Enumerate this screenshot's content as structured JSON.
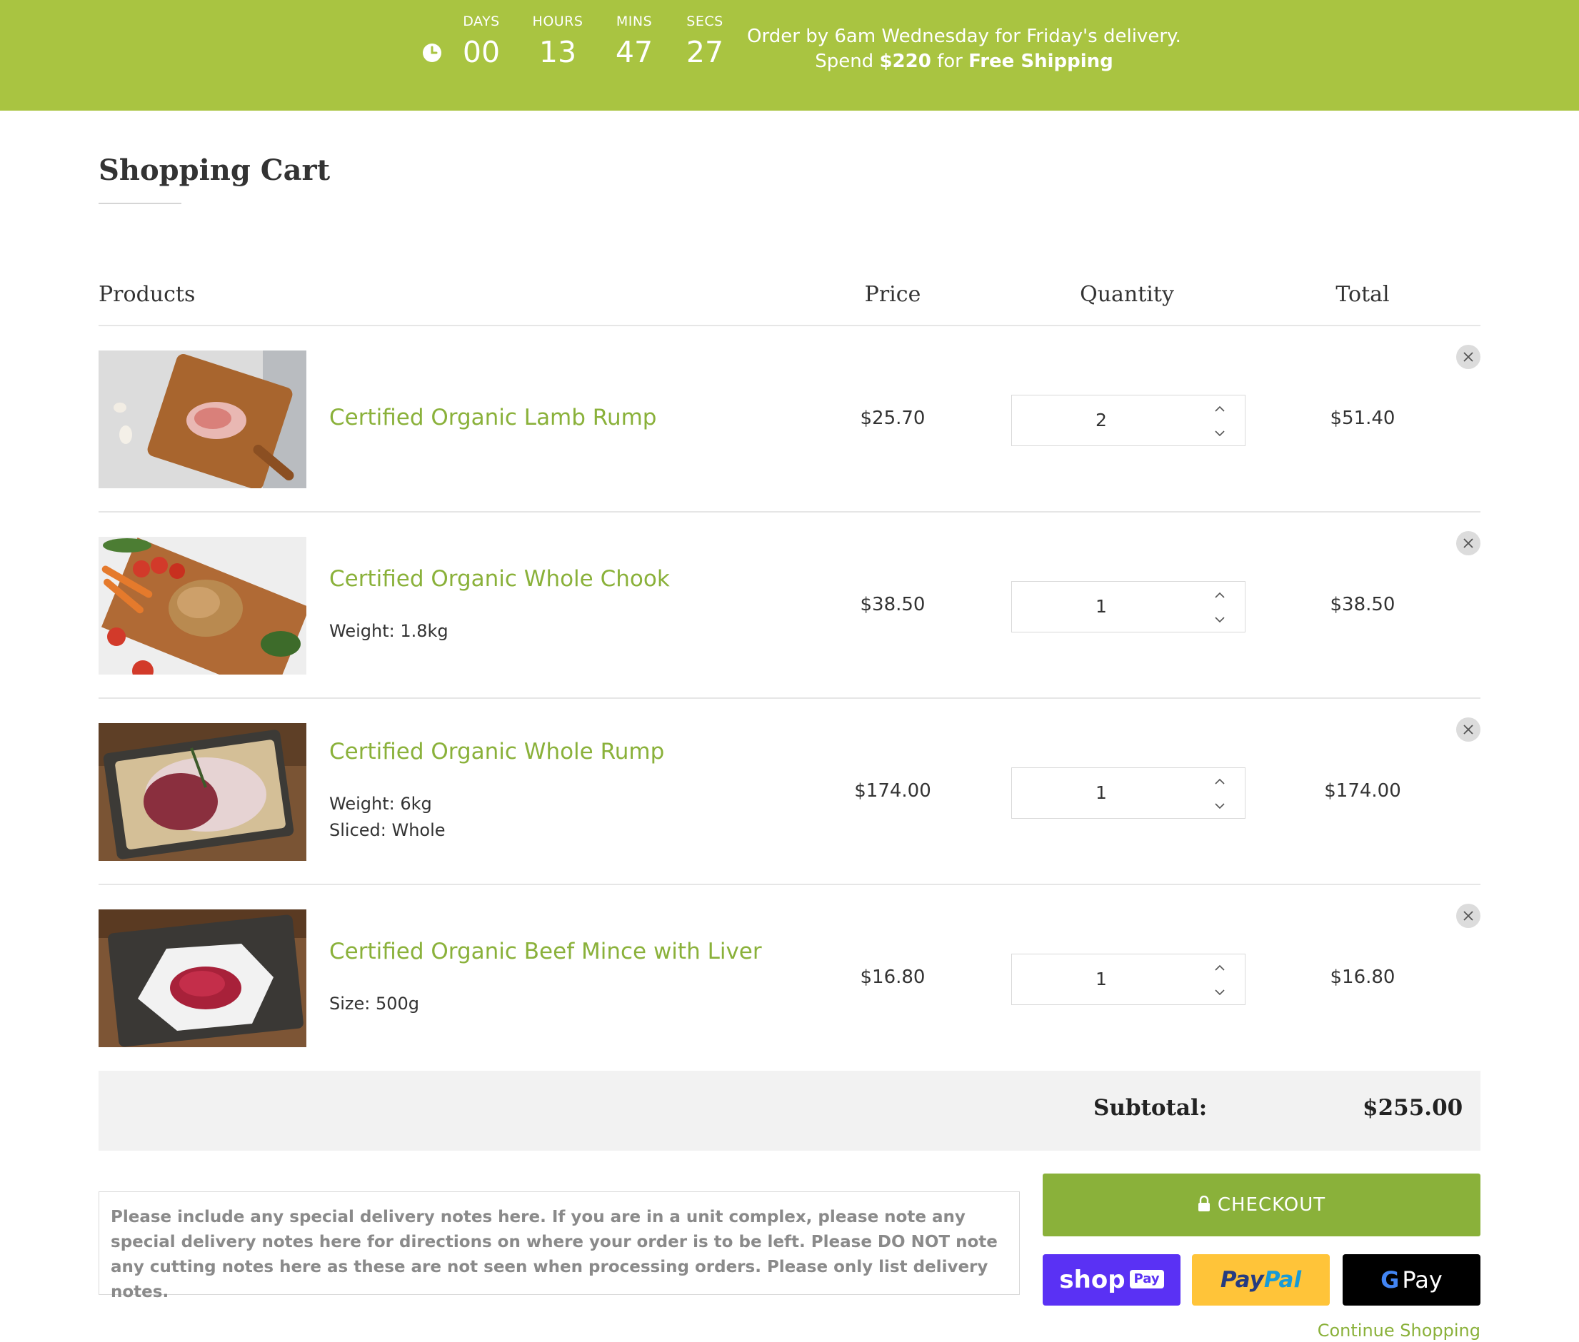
{
  "banner": {
    "countdown": [
      {
        "label": "DAYS",
        "value": "00"
      },
      {
        "label": "HOURS",
        "value": "13"
      },
      {
        "label": "MINS",
        "value": "47"
      },
      {
        "label": "SECS",
        "value": "27"
      }
    ],
    "message_line1": "Order by 6am Wednesday for Friday's delivery.",
    "message_spend": "Spend",
    "message_amount": "$220",
    "message_for": "for",
    "message_free_shipping": "Free Shipping",
    "background_color": "#a9c441"
  },
  "page": {
    "title": "Shopping Cart"
  },
  "table": {
    "headers": {
      "products": "Products",
      "price": "Price",
      "quantity": "Quantity",
      "total": "Total"
    }
  },
  "cart_items": [
    {
      "name": "Certified Organic Lamb Rump",
      "options": [],
      "price": "$25.70",
      "quantity": "2",
      "total": "$51.40"
    },
    {
      "name": "Certified Organic Whole Chook",
      "options": [
        "Weight: 1.8kg"
      ],
      "price": "$38.50",
      "quantity": "1",
      "total": "$38.50"
    },
    {
      "name": "Certified Organic Whole Rump",
      "options": [
        "Weight: 6kg",
        "Sliced: Whole"
      ],
      "price": "$174.00",
      "quantity": "1",
      "total": "$174.00"
    },
    {
      "name": "Certified Organic Beef Mince with Liver",
      "options": [
        "Size: 500g"
      ],
      "price": "$16.80",
      "quantity": "1",
      "total": "$16.80"
    }
  ],
  "summary": {
    "subtotal_label": "Subtotal:",
    "subtotal_value": "$255.00"
  },
  "notes": {
    "placeholder": "Please include any special delivery notes here. If you are in a unit complex, please note any special delivery notes here for directions on where your order is to be left. Please DO NOT note any cutting notes here as these are not seen when processing orders. Please only list delivery notes."
  },
  "checkout": {
    "checkout_label": "CHECKOUT",
    "shoppay_label": "shop",
    "shoppay_pill": "Pay",
    "paypal_part1": "Pay",
    "paypal_part2": "Pal",
    "gpay_g": "G",
    "gpay_label": "Pay",
    "continue_label": "Continue Shopping",
    "accent_color": "#8ab13a"
  }
}
